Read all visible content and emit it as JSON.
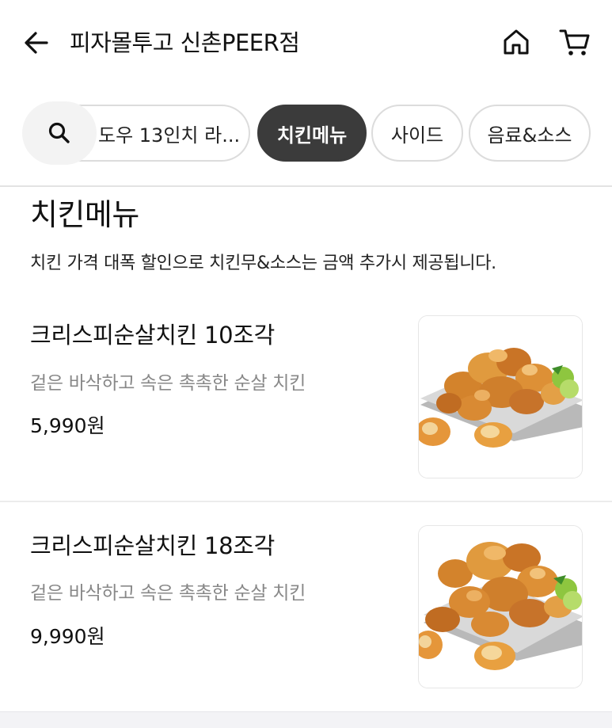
{
  "header": {
    "store_title": "피자몰투고 신촌PEER점",
    "back_icon": "arrow-left-icon",
    "home_icon": "home-icon",
    "cart_icon": "cart-icon"
  },
  "categories": {
    "search_icon": "search-icon",
    "items": [
      {
        "label": "도우 13인치 라...",
        "active": false
      },
      {
        "label": "치킨메뉴",
        "active": true
      },
      {
        "label": "사이드",
        "active": false
      },
      {
        "label": "음료&소스",
        "active": false
      }
    ]
  },
  "section": {
    "title": "치킨메뉴",
    "description": "치킨 가격 대폭 할인으로 치킨무&소스는 금액 추가시 제공됩니다."
  },
  "menu_items": [
    {
      "name": "크리스피순살치킨 10조각",
      "description": "겉은 바삭하고 속은 촉촉한 순살 치킨",
      "price": "5,990원"
    },
    {
      "name": "크리스피순살치킨 18조각",
      "description": "겉은 바삭하고 속은 촉촉한 순살 치킨",
      "price": "9,990원"
    }
  ],
  "colors": {
    "active_chip": "#3b3b3b",
    "chip_border": "#dcdcdc",
    "muted_text": "#888888",
    "divider": "#e3e3e3"
  }
}
